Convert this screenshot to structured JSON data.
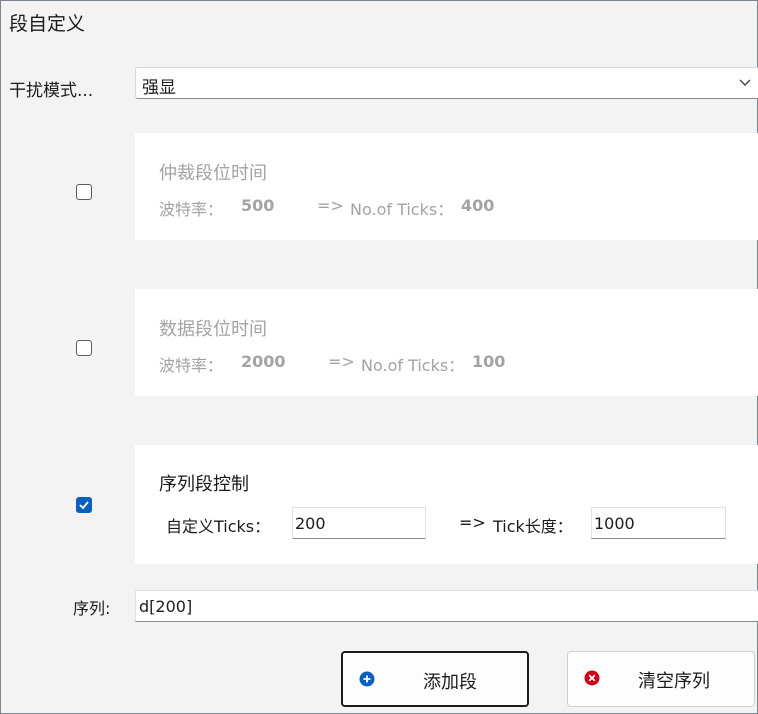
{
  "title": "段自定义",
  "interference": {
    "label": "干扰模式...",
    "value": "强显"
  },
  "cards": [
    {
      "title": "仲裁段位时间",
      "baud_label": "波特率：",
      "baud_value": "500",
      "arrow": "=>",
      "ticks_label": "No.of Ticks：",
      "ticks_value": "400",
      "checked": false,
      "enabled": false
    },
    {
      "title": "数据段位时间",
      "baud_label": "波特率：",
      "baud_value": "2000",
      "arrow": "=>",
      "ticks_label": "No.of Ticks：",
      "ticks_value": "100",
      "checked": false,
      "enabled": false
    },
    {
      "title": "序列段控制",
      "custom_label": "自定义Ticks：",
      "custom_value": "200",
      "arrow": "=>",
      "length_label": "Tick长度：",
      "length_value": "1000",
      "checked": true,
      "enabled": true
    }
  ],
  "sequence": {
    "label": "序列:",
    "value": "d[200]"
  },
  "buttons": {
    "add": "添加段",
    "clear": "清空序列"
  },
  "colors": {
    "accent": "#0c5fbf",
    "danger": "#d0021b",
    "disabled_text": "#a3a3a3"
  }
}
